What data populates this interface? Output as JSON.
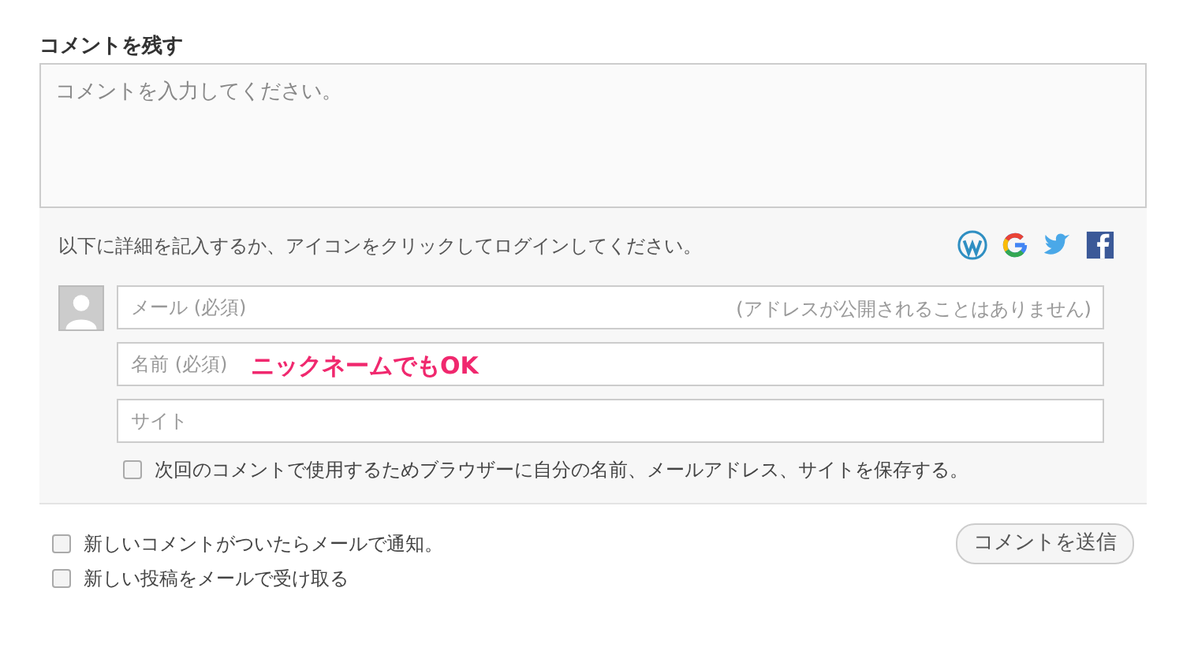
{
  "heading": "コメントを残す",
  "comment_box": {
    "placeholder": "コメントを入力してください。"
  },
  "login_prompt": "以下に詳細を記入するか、アイコンをクリックしてログインしてください。",
  "login_services": [
    {
      "kind": "wordpress"
    },
    {
      "kind": "google"
    },
    {
      "kind": "twitter"
    },
    {
      "kind": "facebook"
    }
  ],
  "fields": [
    {
      "placeholder": "メール (必須)",
      "note": "(アドレスが公開されることはありません)"
    },
    {
      "placeholder": "名前 (必須)",
      "annotation": "ニックネームでもOK"
    },
    {
      "placeholder": "サイト"
    }
  ],
  "save_info": {
    "label": "次回のコメントで使用するためブラウザーに自分の名前、メールアドレス、サイトを保存する。",
    "checked": false
  },
  "subscriptions": [
    {
      "label": "新しいコメントがついたらメールで通知。",
      "checked": false
    },
    {
      "label": "新しい投稿をメールで受け取る",
      "checked": false
    }
  ],
  "submit_button": "コメントを送信"
}
